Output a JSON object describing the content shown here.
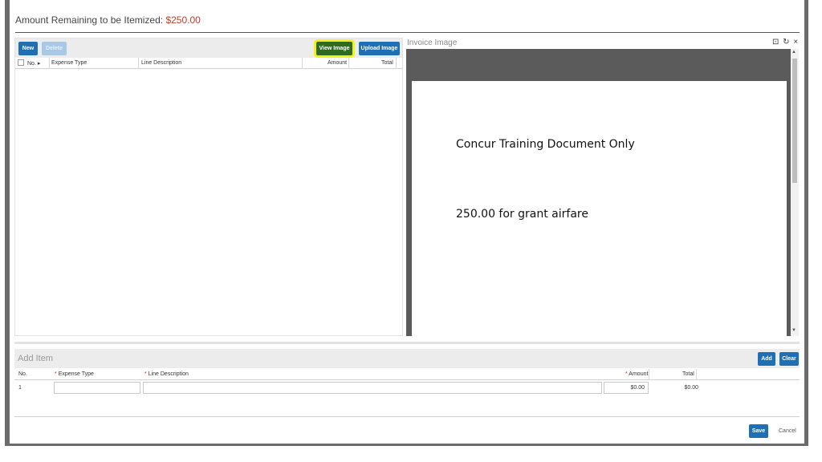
{
  "header": {
    "amount_label": "Amount Remaining to be Itemized:",
    "amount_value": "$250.00",
    "amount_color": "#c0392b"
  },
  "list": {
    "toolbar": {
      "new_label": "New",
      "delete_label": "Delete",
      "view_image_label": "View Image",
      "upload_image_label": "Upload Image"
    },
    "columns": [
      "No.",
      "Expense Type",
      "Line Description",
      "Amount",
      "Total"
    ],
    "sort_indicator": "▸"
  },
  "invoice": {
    "title": "Invoice Image",
    "controls": "⊡ ↻ ×",
    "document_lines": [
      "Concur Training Document Only",
      "250.00 for grant airfare"
    ]
  },
  "add_item": {
    "title": "Add Item",
    "add_label": "Add",
    "clear_label": "Clear",
    "columns": {
      "no": "No.",
      "expense_type": "Expense Type",
      "line_description": "Line Description",
      "amount": "Amount",
      "total": "Total"
    },
    "required_marker": "*",
    "row": {
      "number": "1",
      "expense_type": "",
      "line_description": "",
      "amount": "$0.00",
      "total": "$0.00"
    }
  },
  "footer": {
    "save_label": "Save",
    "cancel_label": "Cancel"
  },
  "colors": {
    "primary_button": "#1f6fb5",
    "highlight": "#f2f21a",
    "viewer_background": "#5b5b5b"
  }
}
